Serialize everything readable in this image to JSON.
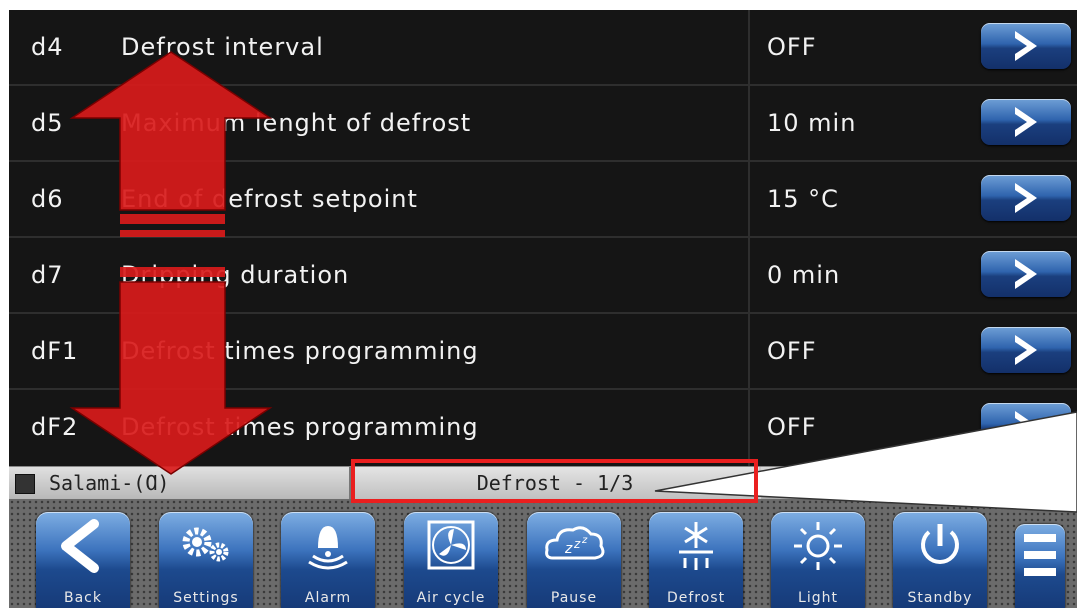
{
  "parameters": [
    {
      "code": "d4",
      "label": "Defrost interval",
      "value": "OFF"
    },
    {
      "code": "d5",
      "label": "Maximum lenght of defrost",
      "value": "10  min"
    },
    {
      "code": "d6",
      "label": "End of defrost setpoint",
      "value": "15  °C"
    },
    {
      "code": "d7",
      "label": "Dripping duration",
      "value": "0  min"
    },
    {
      "code": "dF1",
      "label": "Defrost times programming",
      "value": "OFF"
    },
    {
      "code": "dF2",
      "label": "Defrost times programming",
      "value": "OFF"
    }
  ],
  "status": {
    "zone": "Salami-(Ɑ)",
    "page": "Defrost - 1/3"
  },
  "toolbar": {
    "back": "Back",
    "settings": "Settings",
    "alarm": "Alarm",
    "air_cycle": "Air cycle",
    "pause": "Pause",
    "defrost": "Defrost",
    "light": "Light",
    "standby": "Standby"
  },
  "colors": {
    "annotation": "#ea1f1f",
    "button_blue": "#2f64ae",
    "panel": "#151515"
  },
  "icons": [
    "chevron-right-icon",
    "back-arrow-icon",
    "gears-icon",
    "alarm-bell-icon",
    "fan-icon",
    "sleep-cloud-icon",
    "snowflake-icon",
    "sun-icon",
    "power-icon",
    "menu-icon",
    "scroll-arrow-icon"
  ]
}
